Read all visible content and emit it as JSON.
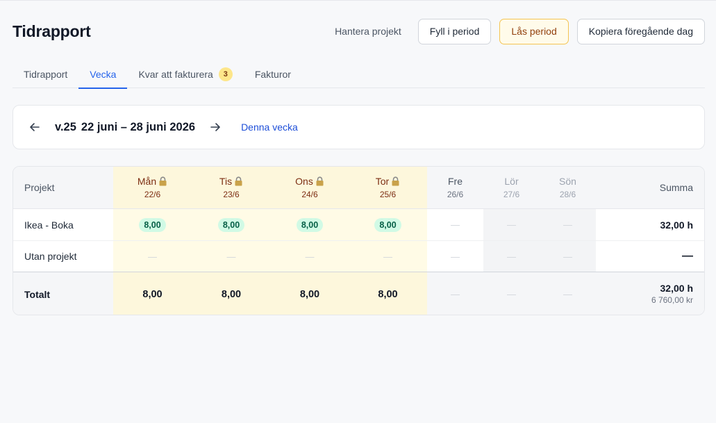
{
  "header": {
    "title": "Tidrapport",
    "manage_projects": "Hantera projekt",
    "fill_period": "Fyll i period",
    "lock_period": "Lås period",
    "copy_prev_day": "Kopiera föregående dag"
  },
  "tabs": [
    {
      "label": "Tidrapport"
    },
    {
      "label": "Vecka"
    },
    {
      "label": "Kvar att fakturera",
      "badge": "3"
    },
    {
      "label": "Fakturor"
    }
  ],
  "week": {
    "number": "v.25",
    "range": "22 juni – 28 juni 2026",
    "today_link": "Denna vecka"
  },
  "grid": {
    "project_header": "Projekt",
    "sum_header": "Summa",
    "days": [
      {
        "name": "Mån",
        "date": "22/6"
      },
      {
        "name": "Tis",
        "date": "23/6"
      },
      {
        "name": "Ons",
        "date": "24/6"
      },
      {
        "name": "Tor",
        "date": "25/6"
      },
      {
        "name": "Fre",
        "date": "26/6"
      },
      {
        "name": "Lör",
        "date": "27/6"
      },
      {
        "name": "Sön",
        "date": "28/6"
      }
    ],
    "rows": [
      {
        "project": "Ikea - Boka",
        "values": [
          "8,00",
          "8,00",
          "8,00",
          "8,00",
          "—",
          "—",
          "—"
        ],
        "sum": "32,00 h"
      },
      {
        "project": "Utan projekt",
        "values": [
          "—",
          "—",
          "—",
          "—",
          "—",
          "—",
          "—"
        ],
        "sum": "—"
      }
    ],
    "total": {
      "label": "Totalt",
      "values": [
        "8,00",
        "8,00",
        "8,00",
        "8,00",
        "—",
        "—",
        "—"
      ],
      "sum": "32,00 h",
      "amount": "6 760,00 kr"
    }
  },
  "icons": {
    "lock": "lock-icon",
    "prev": "arrow-left-icon",
    "next": "arrow-right-icon"
  },
  "colors": {
    "accent": "#2563eb",
    "locked_bg": "#fffbe6",
    "pill_bg": "#d1fae5",
    "warn_border": "#f5c451"
  }
}
